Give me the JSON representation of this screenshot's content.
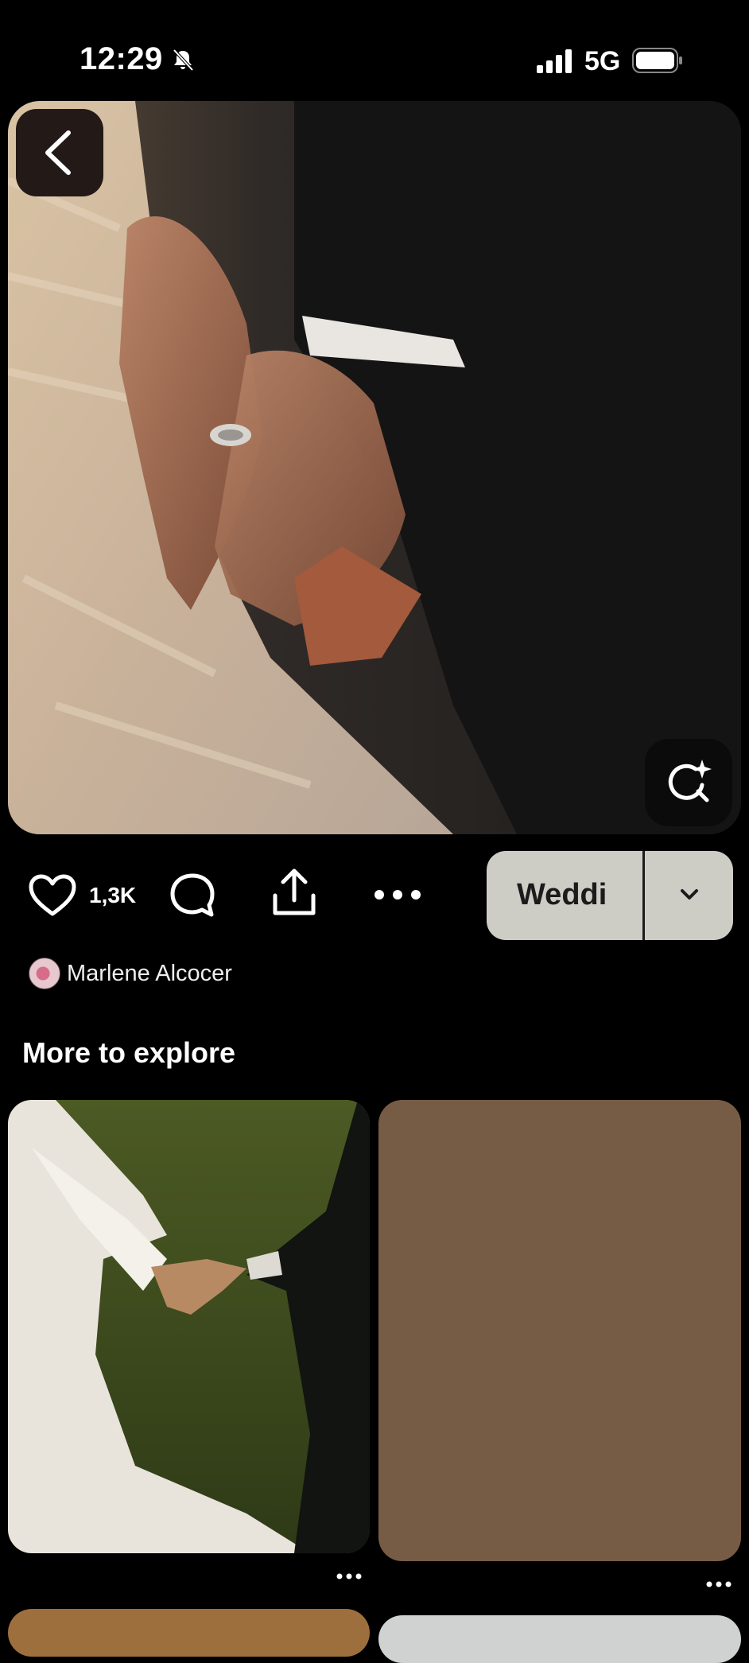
{
  "status_bar": {
    "time": "12:29",
    "network": "5G",
    "icons": [
      "bell-slash-icon",
      "signal-icon",
      "battery-icon"
    ]
  },
  "pin": {
    "image_description_icon": "wedding-hands-photo",
    "back_icon": "chevron-left-icon",
    "visual_search_icon": "visual-search-icon"
  },
  "actions": {
    "like_count": "1,3K",
    "board_label": "Weddi",
    "icons": [
      "heart-icon",
      "comment-icon",
      "share-icon",
      "more-icon",
      "chevron-down-icon"
    ]
  },
  "author": {
    "name": "Marlene Alcocer"
  },
  "explore": {
    "title": "More to explore",
    "more_label": "..."
  },
  "colors": {
    "background": "#000000",
    "board_button": "#cdcdc6",
    "placeholder_pin": "#775c45"
  }
}
